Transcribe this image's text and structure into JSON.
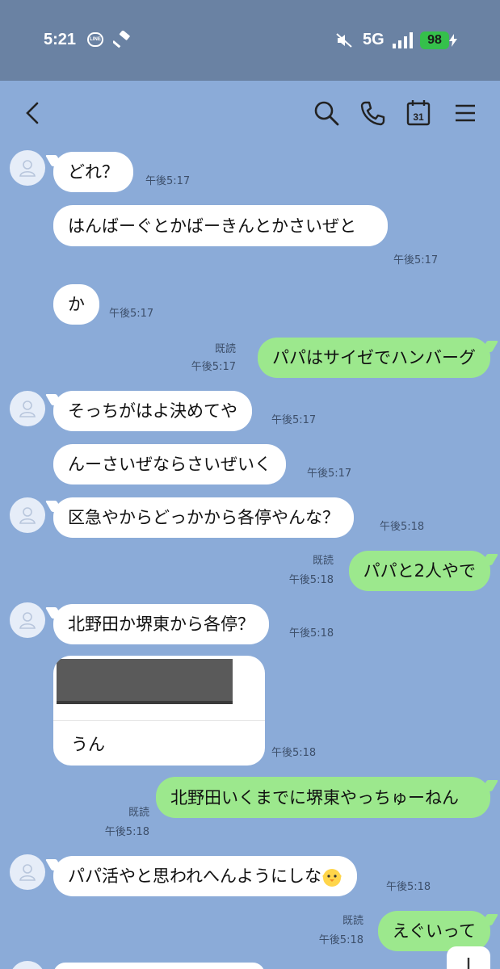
{
  "status_bar": {
    "time": "5:21",
    "line_label": "LINE",
    "network": "5G",
    "battery": "98"
  },
  "messages": [
    {
      "dir": "in",
      "text": "どれ？",
      "time": "午後5:17"
    },
    {
      "dir": "in",
      "text": "はんばーぐとかばーきんとかさいぜと",
      "time": "午後5:17"
    },
    {
      "dir": "in",
      "text": "か",
      "time": "午後5:17"
    },
    {
      "dir": "out",
      "text": "パパはサイゼでハンバーグ",
      "read": "既読",
      "time": "午後5:17"
    },
    {
      "dir": "in",
      "text": "そっちがはよ決めてや",
      "time": "午後5:17"
    },
    {
      "dir": "in",
      "text": "んーさいぜならさいぜいく",
      "time": "午後5:17"
    },
    {
      "dir": "in",
      "text": "区急やからどっかから各停やんな？",
      "time": "午後5:18"
    },
    {
      "dir": "out",
      "text": "パパと2人やで",
      "read": "既読",
      "time": "午後5:18"
    },
    {
      "dir": "in",
      "text": "北野田か堺東から各停？",
      "time": "午後5:18"
    },
    {
      "dir": "in",
      "text": "うん",
      "time": "午後5:18"
    },
    {
      "dir": "out",
      "text": "北野田いくまでに堺東やっちゅーねん",
      "read": "既読",
      "time": "午後5:18"
    },
    {
      "dir": "in",
      "text": "パパ活やと思われへんようにしな",
      "time": "午後5:18"
    },
    {
      "dir": "out",
      "text": "えぐいって",
      "read": "既読",
      "time": "午後5:18"
    }
  ],
  "colors": {
    "chat_bg": "#8babd8",
    "status_bg": "#6a82a3",
    "incoming": "#ffffff",
    "outgoing": "#9ce88d"
  },
  "icons": [
    "back-arrow-icon",
    "search-icon",
    "phone-icon",
    "calendar-icon",
    "menu-icon",
    "avatar-icon",
    "scroll-down-icon"
  ],
  "calendar_day": "31"
}
